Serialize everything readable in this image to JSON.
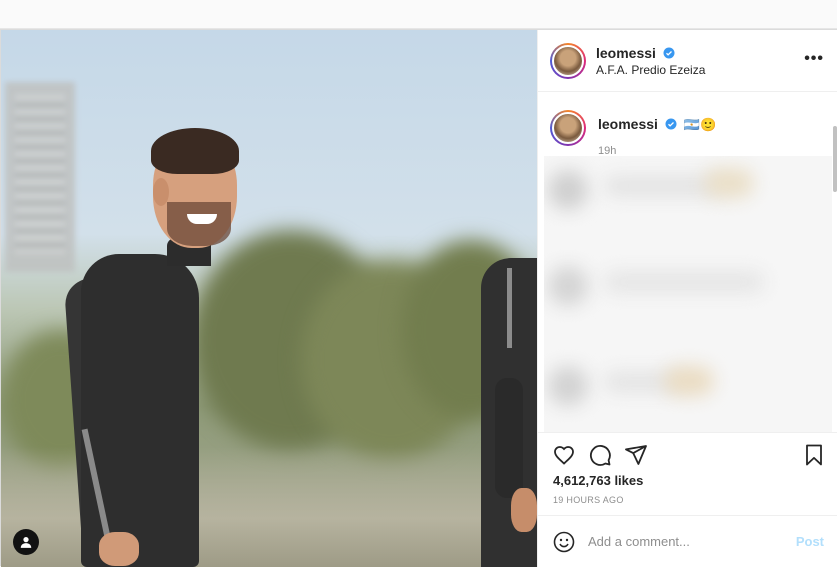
{
  "post": {
    "username": "leomessi",
    "location": "A.F.A. Predio Ezeiza",
    "more_label": "•••"
  },
  "caption": {
    "username": "leomessi",
    "emoji": "🇦🇷🙂",
    "time": "19h"
  },
  "actions": {
    "likes": "4,612,763 likes",
    "time_ago": "19 HOURS AGO"
  },
  "comment": {
    "placeholder": "Add a comment...",
    "post_label": "Post"
  },
  "icons": [
    "heart-icon",
    "comment-icon",
    "share-icon",
    "bookmark-icon",
    "emoji-icon",
    "verified-icon",
    "user-tag-icon",
    "more-icon"
  ],
  "colors": {
    "verified": "#3897f0",
    "post_disabled": "#b2dffc",
    "text": "#262626",
    "secondary": "#8e8e8e"
  }
}
